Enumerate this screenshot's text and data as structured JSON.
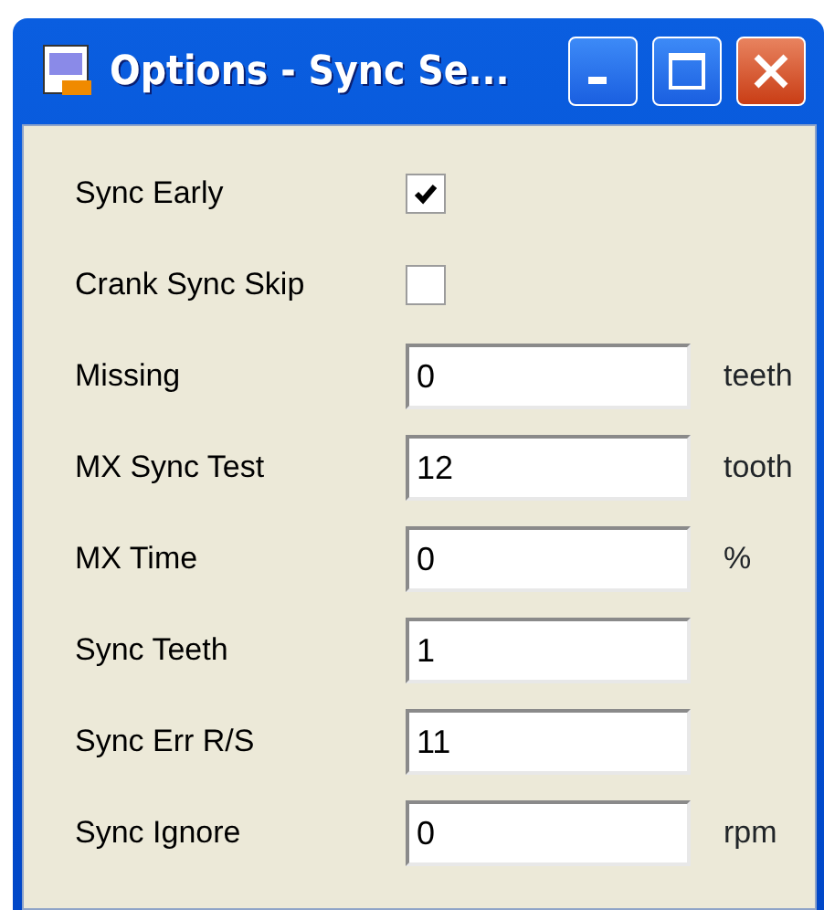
{
  "window": {
    "title": "Options - Sync Se..."
  },
  "rows": [
    {
      "kind": "checkbox",
      "label": "Sync Early",
      "checked": true
    },
    {
      "kind": "checkbox",
      "label": "Crank Sync Skip",
      "checked": false
    },
    {
      "kind": "field",
      "label": "Missing",
      "value": "0",
      "unit": "teeth"
    },
    {
      "kind": "field",
      "label": "MX Sync Test",
      "value": "12",
      "unit": "tooth"
    },
    {
      "kind": "field",
      "label": "MX Time",
      "value": "0",
      "unit": "%"
    },
    {
      "kind": "field",
      "label": "Sync Teeth",
      "value": "1"
    },
    {
      "kind": "field",
      "label": "Sync Err R/S",
      "value": "11"
    },
    {
      "kind": "field",
      "label": "Sync Ignore",
      "value": "0",
      "unit": "rpm"
    }
  ]
}
